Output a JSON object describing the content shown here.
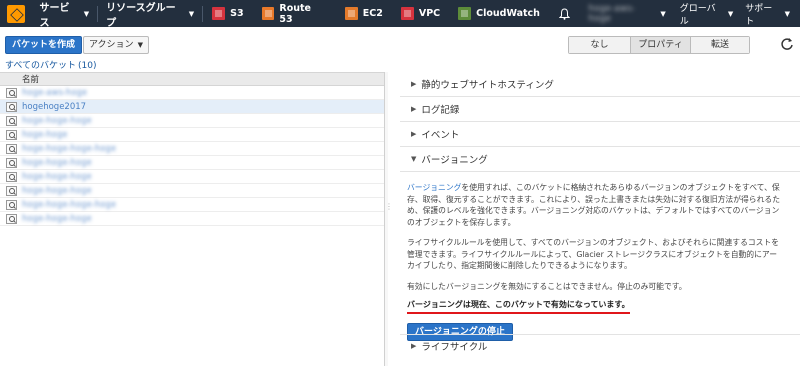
{
  "nav": {
    "services": "サービス",
    "resource_groups": "リソースグループ",
    "shortcuts": [
      {
        "label": "S3",
        "icon": "s3-icon"
      },
      {
        "label": "Route 53",
        "icon": "route53-icon"
      },
      {
        "label": "EC2",
        "icon": "ec2-icon"
      },
      {
        "label": "VPC",
        "icon": "vpc-icon"
      },
      {
        "label": "CloudWatch",
        "icon": "cloudwatch-icon"
      }
    ],
    "account": "hoge-aws-hoge",
    "region": "グローバル",
    "support": "サポート"
  },
  "toolbar": {
    "create_bucket": "バケットを作成",
    "actions": "アクション",
    "view_none": "なし",
    "view_properties": "プロパティ",
    "view_transfer": "転送"
  },
  "all_buckets": {
    "label": "すべてのバケット",
    "count": "(10)"
  },
  "bucket_list": {
    "column_name": "名前",
    "buckets": [
      {
        "name": "hoge-aws-hoge",
        "blurred": true
      },
      {
        "name": "hogehoge2017",
        "blurred": false,
        "selected": true
      },
      {
        "name": "hoge-hoge-hoge",
        "blurred": true
      },
      {
        "name": "hoge-hoge",
        "blurred": true
      },
      {
        "name": "hoge-hoge-hoge-hoge",
        "blurred": true
      },
      {
        "name": "hoge-hoge-hoge",
        "blurred": true
      },
      {
        "name": "hoge-hoge-hoge",
        "blurred": true
      },
      {
        "name": "hoge-hoge-hoge",
        "blurred": true
      },
      {
        "name": "hoge-hoge-hoge-hoge",
        "blurred": true
      },
      {
        "name": "hoge-hoge-hoge",
        "blurred": true
      }
    ]
  },
  "properties": {
    "static_hosting": "静的ウェブサイトホスティング",
    "logging": "ログ記録",
    "events": "イベント",
    "versioning": "バージョニング",
    "versioning_link": "バージョニング",
    "para1": "を使用すれば、このバケットに格納されたあらゆるバージョンのオブジェクトをすべて、保存、取得、復元することができます。これにより、誤った上書きまたは失効に対する復旧方法が得られるため、保護のレベルを強化できます。バージョニング対応のバケットは、デフォルトではすべてのバージョンのオブジェクトを保存します。",
    "para2": "ライフサイクルルールを使用して、すべてのバージョンのオブジェクト、およびそれらに関連するコストを管理できます。ライフサイクルルールによって、Glacier ストレージクラスにオブジェクトを自動的にアーカイブしたり、指定期間後に削除したりできるようになります。",
    "para3": "有効にしたバージョニングを無効にすることはできません。停止のみ可能です。",
    "status": "バージョニングは現在、このバケットで有効になっています。",
    "suspend_button": "バージョニングの停止",
    "lifecycle": "ライフサイクル"
  }
}
